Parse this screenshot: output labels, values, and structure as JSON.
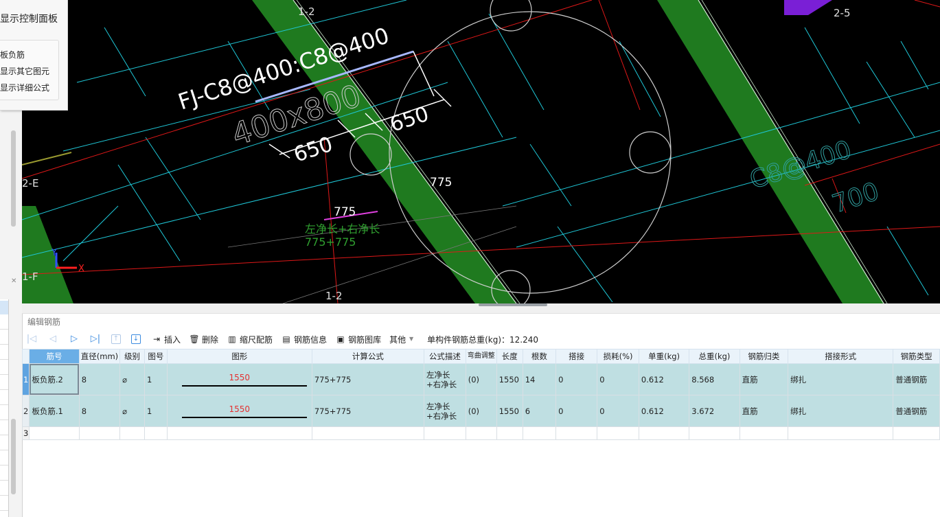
{
  "control_panel": {
    "title": "显示控制面板",
    "options": [
      "板负筋",
      "显示其它图元",
      "显示详细公式"
    ]
  },
  "canvas": {
    "annotation_main": "FJ-C8@400:C8@400",
    "section": "400x800",
    "dim_left": "650",
    "dim_right": "650",
    "dim_upper": "775",
    "dim_lower": "775",
    "formula_text": "左净长+右净长",
    "formula_values": "775+775",
    "side_rebar": "C8@400",
    "side_length": "700",
    "axis_labels": [
      "1-2",
      "2-5",
      "2-E",
      "1-F",
      "1-2"
    ],
    "axis_y": "Y",
    "axis_x": "X"
  },
  "editor": {
    "title": "编辑钢筋",
    "toolbar": {
      "insert": "插入",
      "delete": "删除",
      "scale_rebar": "缩尺配筋",
      "rebar_info": "钢筋信息",
      "rebar_library": "钢筋图库",
      "other": "其他",
      "total_weight": "单构件钢筋总重(kg)：12.240"
    },
    "columns": [
      "筋号",
      "直径(mm)",
      "级别",
      "图号",
      "图形",
      "计算公式",
      "公式描述",
      "弯曲调整",
      "长度",
      "根数",
      "搭接",
      "损耗(%)",
      "单重(kg)",
      "总重(kg)",
      "钢筋归类",
      "搭接形式",
      "钢筋类型"
    ],
    "rows": [
      {
        "n": "1",
        "name": "板负筋.2",
        "dia": "8",
        "grade": "⌀",
        "fig": "1",
        "shape": "1550",
        "formula": "775+775",
        "desc": "左净长+右净长",
        "bend": "(0)",
        "len": "1550",
        "count": "14",
        "lap": "0",
        "loss": "0",
        "unit_w": "0.612",
        "total_w": "8.568",
        "cat": "直筋",
        "lap_type": "绑扎",
        "type": "普通钢筋"
      },
      {
        "n": "2",
        "name": "板负筋.1",
        "dia": "8",
        "grade": "⌀",
        "fig": "1",
        "shape": "1550",
        "formula": "775+775",
        "desc": "左净长+右净长",
        "bend": "(0)",
        "len": "1550",
        "count": "6",
        "lap": "0",
        "loss": "0",
        "unit_w": "0.612",
        "total_w": "3.672",
        "cat": "直筋",
        "lap_type": "绑扎",
        "type": "普通钢筋"
      }
    ],
    "empty_row": "3"
  }
}
